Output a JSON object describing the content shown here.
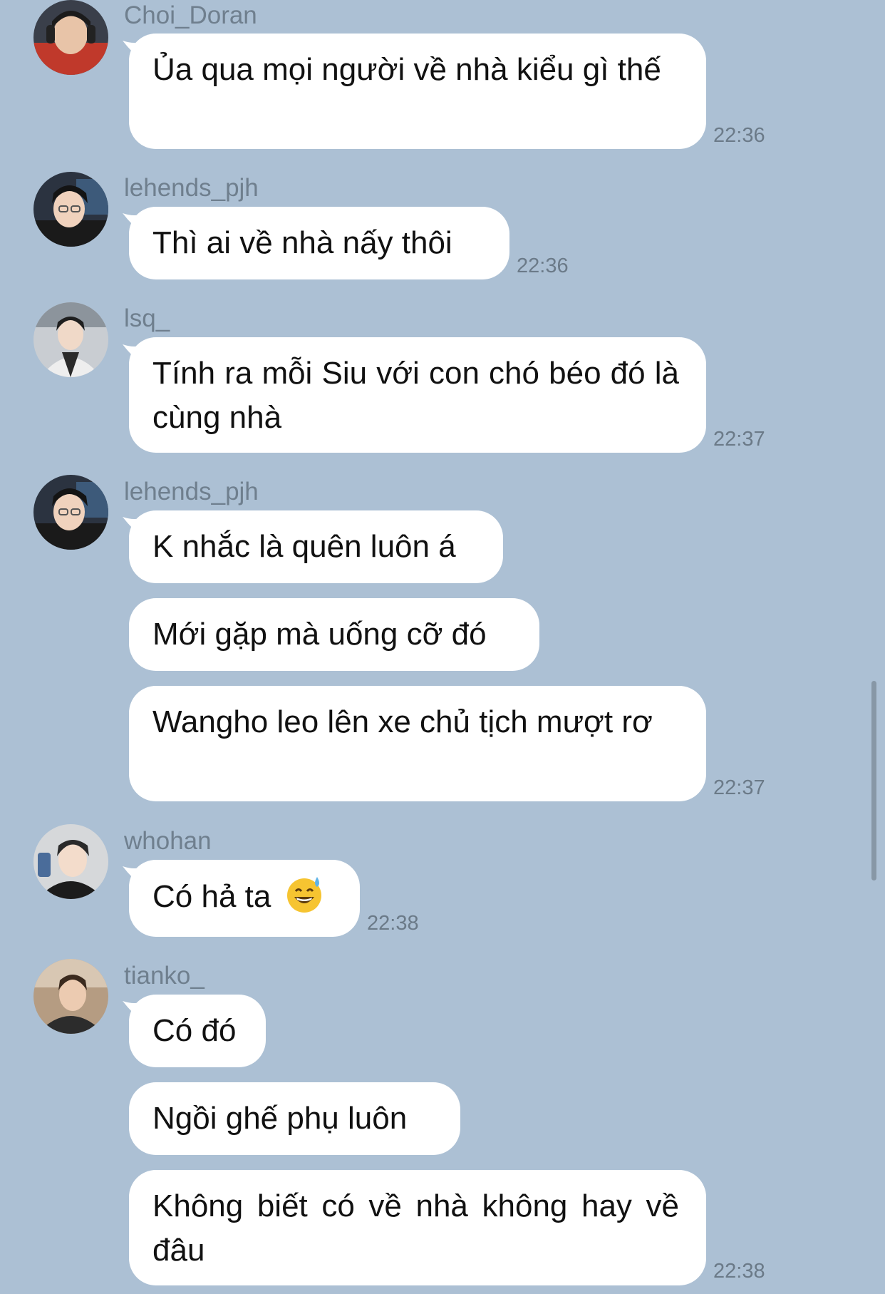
{
  "messages": [
    {
      "sender": "Choi_Doran",
      "texts": [
        "Ủa qua mọi người về nhà kiểu gì thế"
      ],
      "time": "22:36"
    },
    {
      "sender": "lehends_pjh",
      "texts": [
        "Thì ai về nhà nấy thôi"
      ],
      "time": "22:36"
    },
    {
      "sender": "lsq_",
      "texts": [
        "Tính ra mỗi Siu với con chó béo đó là cùng nhà"
      ],
      "time": "22:37"
    },
    {
      "sender": "lehends_pjh",
      "texts": [
        "K nhắc là quên luôn á",
        "Mới gặp mà uống cỡ đó",
        "Wangho leo lên xe chủ tịch mượt rơ"
      ],
      "time": "22:37"
    },
    {
      "sender": "whohan",
      "texts": [
        "Có hả ta"
      ],
      "emoji": "grinning-sweat-emoji",
      "time": "22:38"
    },
    {
      "sender": "tianko_",
      "texts": [
        "Có đó",
        "Ngồi ghế phụ luôn",
        "Không biết có về nhà không hay về đâu"
      ],
      "time": "22:38"
    }
  ],
  "colors": {
    "background": "#acc0d4",
    "bubble": "#ffffff",
    "name_text": "#6f7f8e",
    "time_text": "#6b7a88"
  }
}
